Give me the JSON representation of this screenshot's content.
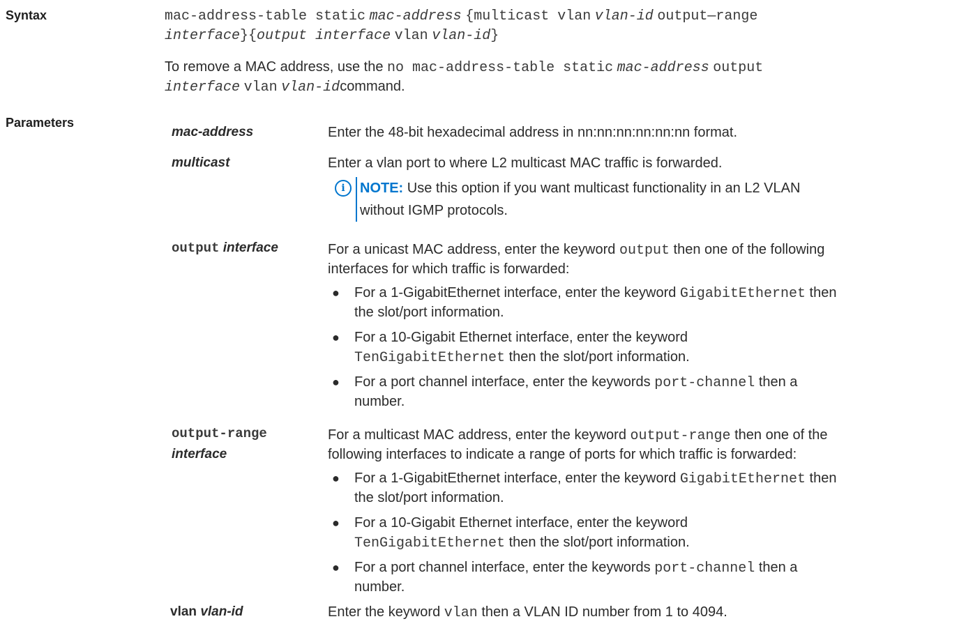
{
  "syntax": {
    "heading": "Syntax",
    "l1_cmd": "mac-address-table static",
    "l1_macaddr": "mac-address",
    "l1_brace": "{multicast vlan",
    "l1_vlanid": "vlan-id",
    "l1_outrange": "output—range",
    "l2_interface": "interface",
    "l2_brace": "}{",
    "l2_output": "output interface",
    "l2_vlan": "vlan",
    "l2_vlanid": "vlan-id",
    "l2_close": "}",
    "remove_prefix": "To remove a MAC address, use the",
    "remove_cmd": "no mac-address-table static",
    "remove_macaddr": "mac-address",
    "remove_output": "output",
    "remove_interface": "interface",
    "remove_vlan": "vlan",
    "remove_vlanid": "vlan-id",
    "remove_suffix": "command."
  },
  "parameters": {
    "heading": "Parameters",
    "mac_address": {
      "term": "mac-address",
      "desc": "Enter the 48-bit hexadecimal address in nn:nn:nn:nn:nn:nn format."
    },
    "multicast": {
      "term": "multicast",
      "desc": "Enter a vlan port to where L2 multicast MAC traffic is forwarded.",
      "note_label": "NOTE:",
      "note_l1": "Use this option if you want multicast functionality in an L2 VLAN",
      "note_l2": "without IGMP protocols."
    },
    "output_interface": {
      "term_kw": "output",
      "term_arg": "interface",
      "d1_a": "For a unicast MAC address, enter the keyword",
      "d1_kw": "output",
      "d1_b": "then one of the following",
      "d2": "interfaces for which traffic is forwarded:",
      "b1_a": "For a 1-GigabitEthernet interface, enter the keyword",
      "b1_kw": "GigabitEthernet",
      "b1_b": "then",
      "b1_c": "the slot/port information.",
      "b2_a": "For a 10-Gigabit Ethernet interface, enter the keyword",
      "b2_kw": "TenGigabitEthernet",
      "b2_b": "then the slot/port information.",
      "b3_a": "For a port channel interface, enter the keywords",
      "b3_kw": "port-channel",
      "b3_b": "then a",
      "b3_c": "number."
    },
    "output_range": {
      "term_kw": "output-range",
      "term_arg": "interface",
      "d1_a": "For a multicast MAC address, enter the keyword",
      "d1_kw": "output-range",
      "d1_b": "then one of the",
      "d2": "following interfaces to indicate a range of ports for which traffic is forwarded:",
      "b1_a": "For a 1-GigabitEthernet interface, enter the keyword",
      "b1_kw": "GigabitEthernet",
      "b1_b": "then",
      "b1_c": "the slot/port information.",
      "b2_a": "For a 10-Gigabit Ethernet interface, enter the keyword",
      "b2_kw": "TenGigabitEthernet",
      "b2_b": "then the slot/port information.",
      "b3_a": "For a port channel interface, enter the keywords",
      "b3_kw": "port-channel",
      "b3_b": "then a",
      "b3_c": "number."
    },
    "vlan": {
      "term_kw": "vlan",
      "term_arg": "vlan-id",
      "d_a": "Enter the keyword",
      "d_kw": "vlan",
      "d_b": "then a VLAN ID number from 1 to 4094."
    }
  }
}
